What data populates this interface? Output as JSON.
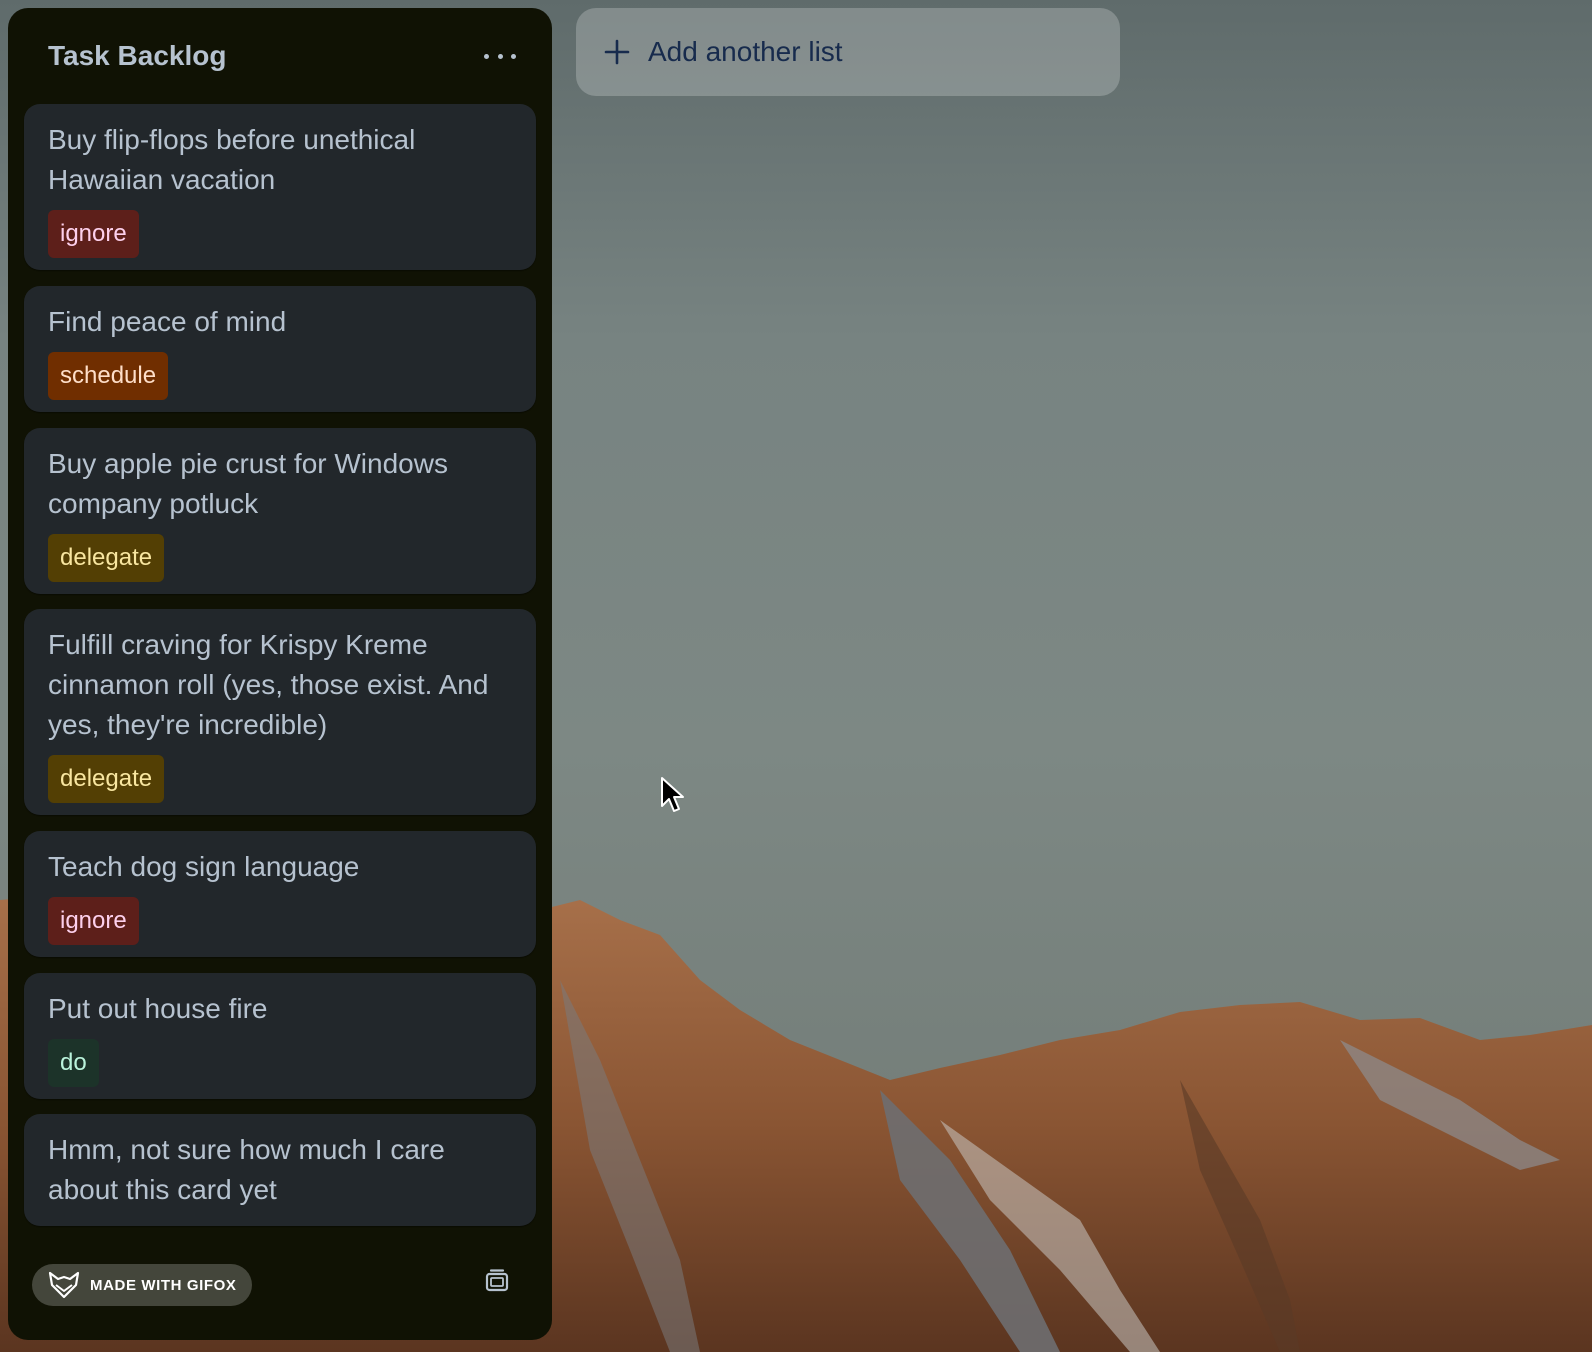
{
  "colors": {
    "list_bg": "#101204",
    "card_bg": "#22272b",
    "text_primary": "#b6c2cf",
    "label_ignore": "#5d1f1a",
    "label_schedule": "#702e00",
    "label_delegate": "#533f04",
    "label_do": "#1c3329"
  },
  "list": {
    "title": "Task Backlog",
    "menu_icon": "more-horizontal-icon",
    "cards": [
      {
        "title": "Buy flip-flops before unethical Hawaiian vacation",
        "label": "ignore"
      },
      {
        "title": "Find peace of mind",
        "label": "schedule"
      },
      {
        "title": "Buy apple pie crust for Windows company potluck",
        "label": "delegate"
      },
      {
        "title": "Fulfill craving for Krispy Kreme cinnamon roll (yes, those exist. And yes, they're incredible)",
        "label": "delegate"
      },
      {
        "title": "Teach dog sign language",
        "label": "ignore"
      },
      {
        "title": "Put out house fire",
        "label": "do"
      },
      {
        "title": "Hmm, not sure how much I care about this card yet"
      }
    ],
    "footer": {
      "watermark_text": "MADE WITH GIFOX",
      "template_icon": "card-template-icon"
    }
  },
  "add_list": {
    "label": "Add another list",
    "icon": "plus-icon"
  }
}
